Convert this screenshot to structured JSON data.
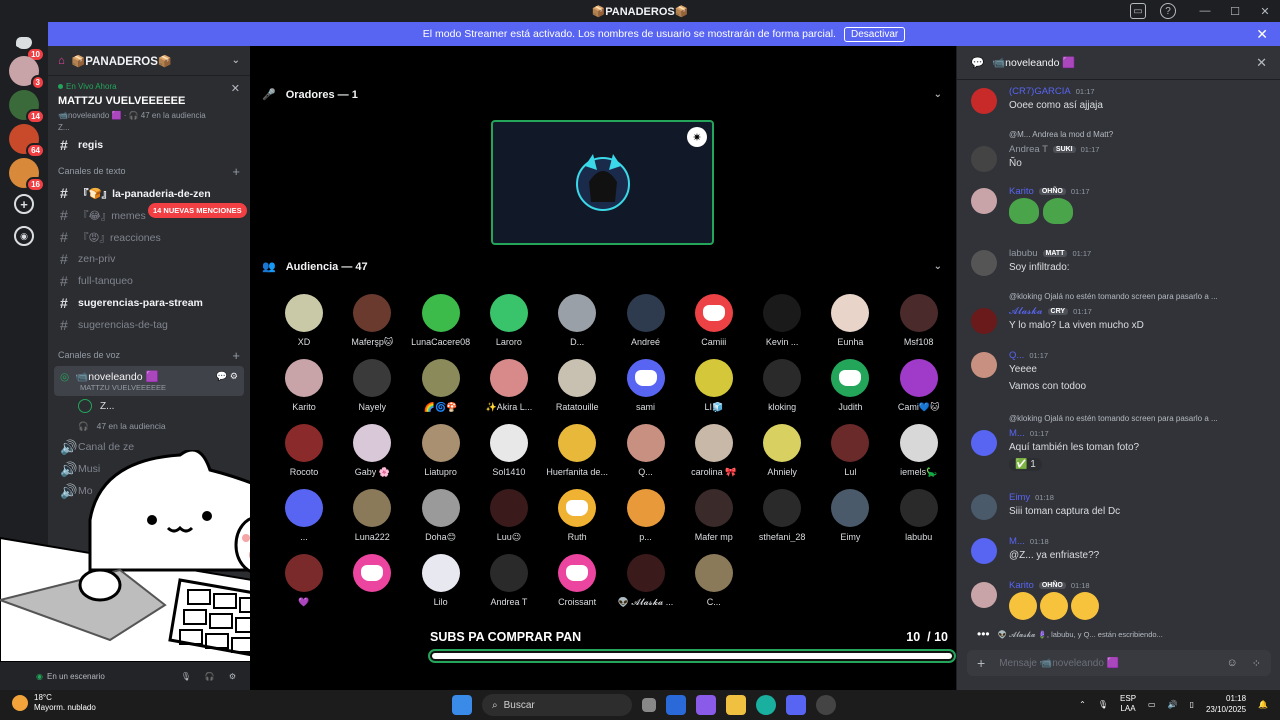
{
  "window": {
    "title": "📦PANADEROS📦"
  },
  "banner": {
    "text": "El modo Streamer está activado. Los nombres de usuario se mostrarán de forma parcial.",
    "button": "Desactivar"
  },
  "rail": {
    "badges": [
      "10",
      "3",
      "14",
      "64",
      "16"
    ]
  },
  "sidebar": {
    "server_name": "📦PANADEROS📦",
    "live": {
      "label": "En Vivo Ahora",
      "title": "MATTZU VUELVEEEEEE",
      "sub": "📹noveleando 🟪 · 🎧 47 en la audiencia",
      "user": "Z..."
    },
    "mentions": "14 NUEVAS MENCIONES",
    "partial_channel": "regis",
    "text_category": "Canales de texto",
    "channels": [
      {
        "label": "『🍞』la-panaderia-de-zen",
        "bold": true
      },
      {
        "label": "『😂』memes",
        "bold": false
      },
      {
        "label": "『😡』reacciones",
        "bold": false
      },
      {
        "label": "zen-priv",
        "bold": false
      },
      {
        "label": "full-tanqueo",
        "bold": false
      },
      {
        "label": "sugerencias-para-stream",
        "bold": true
      },
      {
        "label": "sugerencias-de-tag",
        "bold": false
      }
    ],
    "voice_category": "Canales de voz",
    "voice_channel": {
      "name": "📹noveleando 🟪",
      "sub": "MATTZU VUELVEEEEEE"
    },
    "voice_users": [
      "Z...",
      "47 en la audiencia"
    ],
    "other_voice": [
      "Canal de ze",
      "Musi",
      "Mo"
    ],
    "user_status": "En un escenario"
  },
  "stage": {
    "speakers_header": "Oradores — 1",
    "audience_header": "Audiencia — 47",
    "audience": [
      {
        "name": "XD",
        "color": "#c9c9a8"
      },
      {
        "name": "Maferşp🐱",
        "color": "#6b3a2e"
      },
      {
        "name": "LunaCacere08",
        "color": "#3dbb4a"
      },
      {
        "name": "Laroro",
        "color": "#39c36b"
      },
      {
        "name": "D...",
        "color": "#9aa0a8"
      },
      {
        "name": "Andreé",
        "color": "#2e3b4e"
      },
      {
        "name": "Camiii",
        "color": "#ed4245",
        "discord": true
      },
      {
        "name": "Kevin ...",
        "color": "#1a1a1a"
      },
      {
        "name": "Eunha",
        "color": "#e8d4c8"
      },
      {
        "name": "Msf108",
        "color": "#4a2a2a"
      },
      {
        "name": "Karito",
        "color": "#c8a4a8"
      },
      {
        "name": "Nayely",
        "color": "#3a3a3a"
      },
      {
        "name": "🌈🌀🍄",
        "color": "#8a8a5a"
      },
      {
        "name": "✨Akira L...",
        "color": "#d88a8a"
      },
      {
        "name": "Ratatouille",
        "color": "#c8c0b0"
      },
      {
        "name": "sami",
        "color": "#5865f2",
        "discord": true
      },
      {
        "name": "LI🧊",
        "color": "#d4c83a"
      },
      {
        "name": "kloking",
        "color": "#2a2a2a"
      },
      {
        "name": "Judith",
        "color": "#23a55a",
        "discord": true
      },
      {
        "name": "Cami💙🐱",
        "color": "#a03ac8"
      },
      {
        "name": "Rocoto",
        "color": "#8a2a2a"
      },
      {
        "name": "Gaby 🌸",
        "color": "#d8c8d8"
      },
      {
        "name": "Liatupro",
        "color": "#a89070"
      },
      {
        "name": "Sol1410",
        "color": "#e8e8e8"
      },
      {
        "name": "Huerfanita de...",
        "color": "#e8b83a"
      },
      {
        "name": "Q...",
        "color": "#c89080"
      },
      {
        "name": "carolina 🎀",
        "color": "#c8b8a8"
      },
      {
        "name": "Ahniely",
        "color": "#d8d060"
      },
      {
        "name": "Lul",
        "color": "#6a2a2a"
      },
      {
        "name": "iemels🦕",
        "color": "#d8d8d8"
      },
      {
        "name": "...",
        "color": "#5865f2"
      },
      {
        "name": "Luna222",
        "color": "#8a7a5a"
      },
      {
        "name": "Doha😊",
        "color": "#9a9a9a"
      },
      {
        "name": "Luu😉",
        "color": "#3a1a1a"
      },
      {
        "name": "Ruth",
        "color": "#f0b232",
        "discord": true
      },
      {
        "name": "p...",
        "color": "#e89a3a"
      },
      {
        "name": "Mafer mp",
        "color": "#3a2a2a"
      },
      {
        "name": "sthefani_28",
        "color": "#2a2a2a"
      },
      {
        "name": "Eimy",
        "color": "#4a5a6a"
      },
      {
        "name": "labubu",
        "color": "#2a2a2a"
      },
      {
        "name": "💜",
        "color": "#7a2a2a"
      },
      {
        "name": "",
        "color": "#eb459f",
        "discord": true
      },
      {
        "name": "Lilo",
        "color": "#e8e8f0"
      },
      {
        "name": "Andrea T",
        "color": "#2a2a2a"
      },
      {
        "name": "Croissant",
        "color": "#eb459f",
        "discord": true
      },
      {
        "name": "👽 𝓐𝓵𝓪𝓼𝓴𝓪 ...",
        "color": "#3a1a1a"
      },
      {
        "name": "C...",
        "color": "#8a7a5a"
      }
    ],
    "subs": {
      "label": "SUBS PA COMPRAR PAN",
      "current": "10",
      "total": "10",
      "progress": 1.0
    }
  },
  "chat": {
    "channel": "📹noveleando 🟪",
    "messages": [
      {
        "author": "(CR7)GARCIA",
        "author_color": "#5865f2",
        "time": "01:17",
        "text": "Ooee como así ajjaja",
        "avatar": "#c82a2a"
      },
      {
        "reply": "@M... Andrea la mod d Matt?",
        "author": "Andrea T",
        "author_color": "#949ba4",
        "tag": "SUKI",
        "time": "01:17",
        "text": "Ño",
        "avatar": "#444"
      },
      {
        "author": "Karito",
        "author_color": "#5865f2",
        "tag": "OHÑO",
        "time": "01:17",
        "text": "",
        "frogs": true,
        "avatar": "#c8a4a8"
      },
      {
        "author": "labubu",
        "author_color": "#949ba4",
        "tag": "MATT",
        "time": "01:17",
        "text": "Soy infiltrado:",
        "avatar": "#555"
      },
      {
        "reply": "@kloking Ojalá no estén tomando screen para pasarlo a ...",
        "author": "𝓐𝓵𝓪𝓼𝓴𝓪",
        "author_color": "#5865f2",
        "tag": "CRY",
        "time": "01:17",
        "text": "Y lo malo? La viven mucho xD",
        "avatar": "#6a1a1a"
      },
      {
        "author": "Q...",
        "author_color": "#5865f2",
        "time": "01:17",
        "text": "Yeeee",
        "text2": "Vamos con todoo",
        "avatar": "#c89080"
      },
      {
        "reply": "@kloking Ojalá no estén tomando screen para pasarlo a ...",
        "author": "M...",
        "author_color": "#5865f2",
        "time": "01:17",
        "text": "Aquí también les toman foto?",
        "reaction": "✅ 1",
        "avatar": "#5865f2"
      },
      {
        "author": "Eimy",
        "author_color": "#5865f2",
        "time": "01:18",
        "text": "Siii toman captura del Dc",
        "avatar": "#4a5a6a"
      },
      {
        "author": "M...",
        "author_color": "#5865f2",
        "time": "01:18",
        "text": "@Z... ya enfriaste??",
        "avatar": "#5865f2"
      },
      {
        "author": "Karito",
        "author_color": "#5865f2",
        "tag": "OHÑO",
        "time": "01:18",
        "text": "",
        "laughs": true,
        "avatar": "#c8a4a8"
      }
    ],
    "typing": "👽 𝓐𝓵𝓪𝓼𝓴𝓪 🪻, labubu, y Q... están escribiendo...",
    "input_placeholder": "Mensaje 📹noveleando 🟪"
  },
  "taskbar": {
    "weather_temp": "18°C",
    "weather_desc": "Mayorm. nublado",
    "search": "Buscar",
    "lang": "ESP",
    "region": "LAA",
    "time": "01:18",
    "date": "23/10/2025"
  }
}
